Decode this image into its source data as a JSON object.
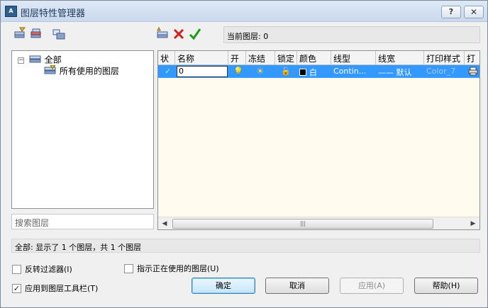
{
  "window": {
    "title": "图层特性管理器",
    "help_glyph": "?",
    "close_glyph": "✕",
    "app_glyph": "A"
  },
  "current_layer_text": "当前图层: 0",
  "tree": {
    "root_expander": "−",
    "root_label": "全部",
    "child_label": "所有使用的图层"
  },
  "search": {
    "placeholder": "搜索图层"
  },
  "grid": {
    "headers": [
      "状",
      "名称",
      "开",
      "冻结",
      "锁定",
      "颜色",
      "线型",
      "线宽",
      "打印样式",
      "打"
    ],
    "row": {
      "status_glyph": "✓",
      "name": "0",
      "on_glyph": "💡",
      "freeze_glyph": "☀",
      "lock_glyph": "🔓",
      "color_name": "白",
      "linetype": "Contin...",
      "lineweight": "—— 默认",
      "plot_style": "Color_7"
    }
  },
  "scrollbar": {
    "left_glyph": "◀",
    "right_glyph": "▶",
    "thumb_glyph": "|||"
  },
  "status_text": "全部: 显示了 1 个图层，共 1 个图层",
  "options": [
    {
      "label": "反转过滤器(I)",
      "checked": false
    },
    {
      "label": "指示正在使用的图层(U)",
      "checked": false
    },
    {
      "label": "应用到图层工具栏(T)",
      "checked": true
    }
  ],
  "check_glyph": "✓",
  "buttons": {
    "ok": "确定",
    "cancel": "取消",
    "apply": "应用(A)",
    "help": "帮助(H)"
  },
  "colors": {
    "selection": "#3399ff",
    "grid_bg": "#fffbef",
    "check_green": "#1a9c1a",
    "delete_red": "#cc2222"
  }
}
